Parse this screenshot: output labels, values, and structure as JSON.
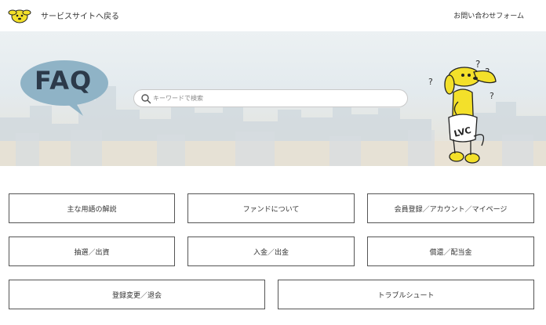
{
  "header": {
    "back_label": "サービスサイトへ戻る",
    "contact_label": "お問い合わせフォーム"
  },
  "hero": {
    "faq_label": "FAQ",
    "search_placeholder": "キーワードで検索",
    "search_value": ""
  },
  "categories": [
    {
      "label": "主な用語の解説"
    },
    {
      "label": "ファンドについて"
    },
    {
      "label": "会員登録／アカウント／マイページ"
    },
    {
      "label": "抽選／出資"
    },
    {
      "label": "入金／出金"
    },
    {
      "label": "償還／配当金"
    },
    {
      "label": "登録変更／退会"
    },
    {
      "label": "トラブルシュート"
    }
  ],
  "colors": {
    "mascot": "#f3e02a",
    "faq_bubble": "#8fb3c6",
    "faq_text": "#2c3a4a"
  },
  "icons": {
    "logo": "yellow-dog-logo-icon",
    "search": "search-icon",
    "mascot": "thinking-dog-mascot"
  }
}
